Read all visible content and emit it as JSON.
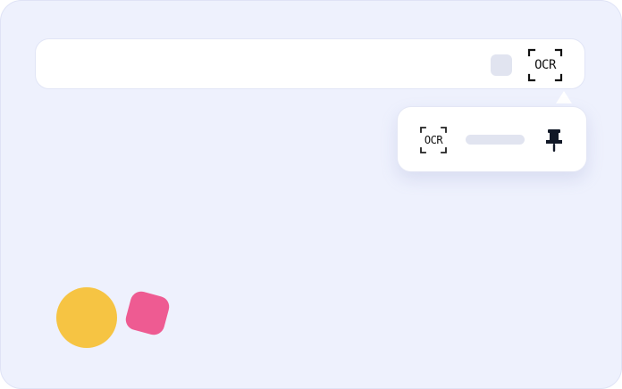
{
  "toolbar": {
    "ocr_button": {
      "label": "OCR",
      "icon": "ocr-scan-icon"
    },
    "extension_placeholder_icon": "extension-placeholder-icon"
  },
  "popup": {
    "item": {
      "label": "OCR",
      "icon": "ocr-scan-icon",
      "pin_icon": "pin-icon"
    }
  },
  "colors": {
    "background": "#eef1fd",
    "surface": "#ffffff",
    "placeholder": "#e1e4f0",
    "icon_dark": "#111827",
    "accent_yellow": "#f6c443",
    "accent_pink": "#ee5b92"
  }
}
